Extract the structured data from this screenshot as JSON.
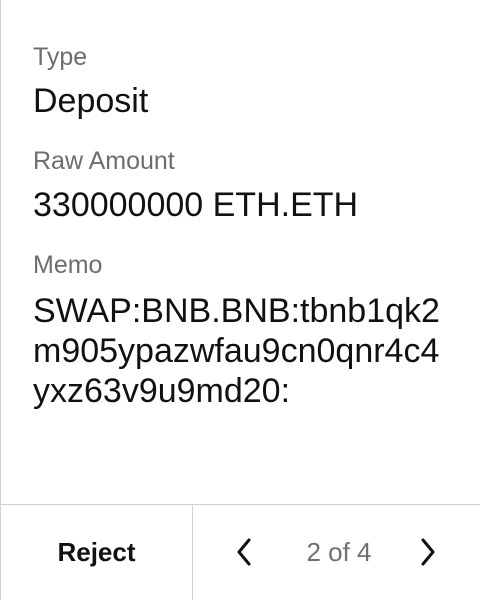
{
  "fields": {
    "type_label": "Type",
    "type_value": "Deposit",
    "raw_amount_label": "Raw Amount",
    "raw_amount_value": "330000000 ETH.ETH",
    "memo_label": "Memo",
    "memo_value": "SWAP:BNB.BNB:tbnb1qk2m905ypazwfau9cn0qnr4c4yxz63v9u9md20:"
  },
  "footer": {
    "reject_label": "Reject",
    "pagination": {
      "text": "2 of 4",
      "current": 2,
      "total": 4,
      "prev_icon": "chevron-left-icon",
      "next_icon": "chevron-right-icon"
    }
  },
  "colors": {
    "text": "#111111",
    "label": "#6d6d6d",
    "border": "#cfcfcf",
    "background": "#ffffff"
  }
}
